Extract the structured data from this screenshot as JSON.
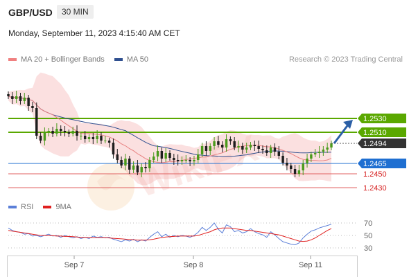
{
  "header": {
    "symbol": "GBP/USD",
    "timeframe": "30 MIN"
  },
  "datetime": "Monday, September 11, 2023 4:15:40 AM CET",
  "copyright": "Research © 2023 Trading Central",
  "legend": [
    {
      "label": "MA 20 + Bollinger Bands",
      "color": "#f08080"
    },
    {
      "label": "MA 50",
      "color": "#2f4f8f"
    }
  ],
  "indicator_legend": [
    {
      "label": "RSI",
      "color": "#5b7fd8"
    },
    {
      "label": "9MA",
      "color": "#e0201f"
    }
  ],
  "chart_data": [
    {
      "type": "candlestick",
      "title": "GBP/USD",
      "x_labels": [
        "Sep 7",
        "Sep 8",
        "Sep 11"
      ],
      "levels": [
        {
          "value": 1.253,
          "label": "1.2530",
          "kind": "resistance",
          "color": "#5aa800"
        },
        {
          "value": 1.251,
          "label": "1.2510",
          "kind": "resistance",
          "color": "#5aa800"
        },
        {
          "value": 1.2494,
          "label": "1.2494",
          "kind": "last",
          "color": "#333333"
        },
        {
          "value": 1.2465,
          "label": "1.2465",
          "kind": "pivot",
          "color": "#1f6fd1"
        },
        {
          "value": 1.245,
          "label": "1.2450",
          "kind": "support",
          "color": "#e06060"
        },
        {
          "value": 1.243,
          "label": "1.2430",
          "kind": "support",
          "color": "#e06060"
        }
      ],
      "ylim": [
        1.2415,
        1.26
      ],
      "close_series": [
        1.2562,
        1.2558,
        1.2562,
        1.2555,
        1.256,
        1.2548,
        1.2545,
        1.2505,
        1.2498,
        1.251,
        1.2512,
        1.2508,
        1.2515,
        1.2512,
        1.251,
        1.2508,
        1.2512,
        1.2505,
        1.2505,
        1.25,
        1.2503,
        1.25,
        1.2505,
        1.2498,
        1.2498,
        1.2495,
        1.2478,
        1.247,
        1.2462,
        1.2472,
        1.2456,
        1.2462,
        1.2452,
        1.246,
        1.2458,
        1.247,
        1.2475,
        1.2483,
        1.2472,
        1.248,
        1.2473,
        1.247,
        1.2468,
        1.247,
        1.247,
        1.2468,
        1.247,
        1.2478,
        1.249,
        1.2483,
        1.249,
        1.2497,
        1.2492,
        1.2488,
        1.25,
        1.2497,
        1.2488,
        1.249,
        1.2485,
        1.2488,
        1.2492,
        1.249,
        1.2486,
        1.2484,
        1.248,
        1.2488,
        1.2482,
        1.2476,
        1.2466,
        1.2462,
        1.2457,
        1.245,
        1.2455,
        1.2465,
        1.2472,
        1.2478,
        1.248,
        1.2482,
        1.2485,
        1.2488,
        1.2494
      ],
      "annotation": {
        "type": "arrow",
        "direction": "up",
        "target": 1.253
      }
    },
    {
      "type": "line",
      "series": [
        {
          "name": "RSI",
          "values": [
            62,
            58,
            56,
            55,
            52,
            53,
            49,
            50,
            48,
            50,
            52,
            49,
            50,
            47,
            50,
            48,
            46,
            48,
            45,
            47,
            45,
            49,
            47,
            48,
            46,
            47,
            44,
            42,
            40,
            43,
            41,
            44,
            40,
            43,
            41,
            47,
            52,
            56,
            48,
            52,
            47,
            50,
            48,
            50,
            49,
            47,
            50,
            55,
            63,
            58,
            63,
            70,
            60,
            54,
            67,
            64,
            56,
            58,
            54,
            56,
            61,
            56,
            53,
            51,
            47,
            56,
            51,
            45,
            40,
            38,
            36,
            35,
            38,
            46,
            52,
            57,
            59,
            62,
            64,
            66,
            68
          ]
        },
        {
          "name": "9MA",
          "values": [
            58,
            57,
            56,
            55,
            54,
            53,
            52,
            51,
            50,
            50,
            50,
            49.5,
            49,
            49,
            48.5,
            48.5,
            48,
            47.5,
            47,
            47,
            46.5,
            46.5,
            46.5,
            46.5,
            46.5,
            46,
            45.5,
            45,
            44.5,
            44,
            43.5,
            43,
            42.5,
            42.5,
            42.5,
            43,
            44,
            45.5,
            46.5,
            47.5,
            48,
            48.5,
            49,
            49,
            49,
            49,
            49,
            50,
            52,
            54,
            56,
            59,
            61,
            62,
            62,
            62,
            61,
            60,
            59,
            58,
            58,
            57,
            56,
            55,
            54,
            53,
            52,
            51,
            49,
            47,
            45,
            43,
            41,
            40.5,
            41,
            43,
            46,
            50,
            54,
            58,
            61
          ]
        }
      ],
      "y_ticks": [
        30,
        50,
        70
      ],
      "ylim": [
        25,
        75
      ],
      "x_labels": [
        "Sep 7",
        "Sep 8",
        "Sep 11"
      ]
    }
  ]
}
